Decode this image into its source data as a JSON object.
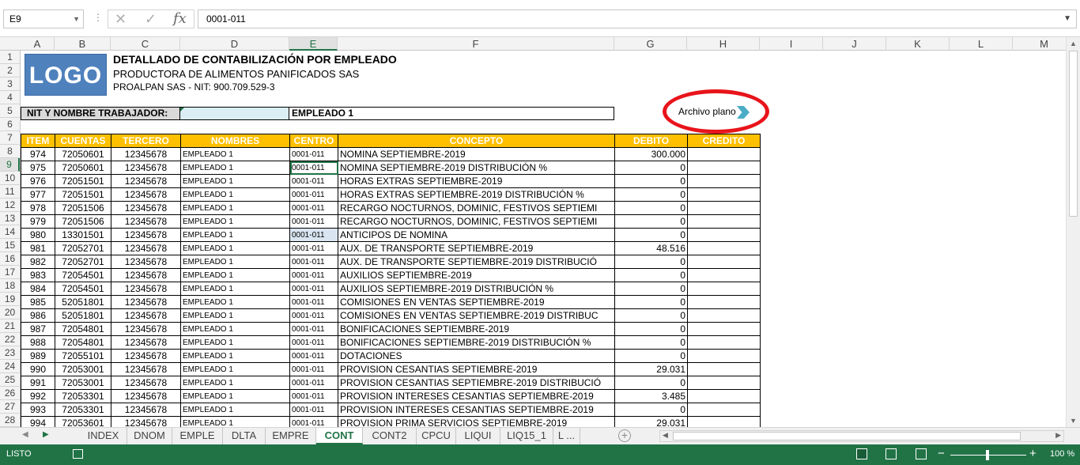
{
  "formula_bar": {
    "name_box": "E9",
    "cancel_icon": "cancel-icon",
    "enter_icon": "check-icon",
    "function_label": "fx",
    "formula_value": "0001-011"
  },
  "columns": [
    "A",
    "B",
    "C",
    "D",
    "E",
    "F",
    "G",
    "H",
    "I",
    "J",
    "K",
    "L",
    "M"
  ],
  "rows": [
    "1",
    "2",
    "3",
    "4",
    "5",
    "6",
    "7",
    "8",
    "9",
    "10",
    "11",
    "12",
    "13",
    "14",
    "15",
    "16",
    "17",
    "18",
    "19",
    "20",
    "21",
    "22",
    "23",
    "24",
    "25",
    "26",
    "27",
    "28"
  ],
  "sheet": {
    "logo_text": "LOGO",
    "title": "DETALLADO DE CONTABILIZACIÓN POR EMPLEADO",
    "company": "PRODUCTORA DE ALIMENTOS PANIFICADOS SAS",
    "nit": "PROALPAN SAS - NIT: 900.709.529-3",
    "worker_label": "NIT Y NOMBRE TRABAJADOR:",
    "worker_name": "EMPLEADO 1",
    "export_button": "Archivo plano",
    "headers": [
      "ITEM",
      "CUENTAS",
      "TERCERO",
      "NOMBRES",
      "CENTRO",
      "CONCEPTO",
      "DEBITO",
      "CREDITO"
    ],
    "rows": [
      {
        "item": "974",
        "cuenta": "72050601",
        "tercero": "12345678",
        "nombre": "EMPLEADO 1",
        "centro": "0001-011",
        "concepto": "NOMINA SEPTIEMBRE-2019",
        "debito": "300.000",
        "credito": ""
      },
      {
        "item": "975",
        "cuenta": "72050601",
        "tercero": "12345678",
        "nombre": "EMPLEADO 1",
        "centro": "0001-011",
        "concepto": "NOMINA SEPTIEMBRE-2019 DISTRIBUCIÓN %",
        "debito": "0",
        "credito": ""
      },
      {
        "item": "976",
        "cuenta": "72051501",
        "tercero": "12345678",
        "nombre": "EMPLEADO 1",
        "centro": "0001-011",
        "concepto": "HORAS EXTRAS SEPTIEMBRE-2019",
        "debito": "0",
        "credito": ""
      },
      {
        "item": "977",
        "cuenta": "72051501",
        "tercero": "12345678",
        "nombre": "EMPLEADO 1",
        "centro": "0001-011",
        "concepto": "HORAS EXTRAS SEPTIEMBRE-2019 DISTRIBUCIÓN %",
        "debito": "0",
        "credito": ""
      },
      {
        "item": "978",
        "cuenta": "72051506",
        "tercero": "12345678",
        "nombre": "EMPLEADO 1",
        "centro": "0001-011",
        "concepto": "RECARGO NOCTURNOS, DOMINIC, FESTIVOS SEPTIEMI",
        "debito": "0",
        "credito": ""
      },
      {
        "item": "979",
        "cuenta": "72051506",
        "tercero": "12345678",
        "nombre": "EMPLEADO 1",
        "centro": "0001-011",
        "concepto": "RECARGO NOCTURNOS, DOMINIC, FESTIVOS SEPTIEMI",
        "debito": "0",
        "credito": ""
      },
      {
        "item": "980",
        "cuenta": "13301501",
        "tercero": "12345678",
        "nombre": "EMPLEADO 1",
        "centro": "0001-011",
        "concepto": "ANTICIPOS DE NOMINA",
        "debito": "0",
        "credito": ""
      },
      {
        "item": "981",
        "cuenta": "72052701",
        "tercero": "12345678",
        "nombre": "EMPLEADO 1",
        "centro": "0001-011",
        "concepto": "AUX. DE TRANSPORTE SEPTIEMBRE-2019",
        "debito": "48.516",
        "credito": ""
      },
      {
        "item": "982",
        "cuenta": "72052701",
        "tercero": "12345678",
        "nombre": "EMPLEADO 1",
        "centro": "0001-011",
        "concepto": "AUX. DE TRANSPORTE SEPTIEMBRE-2019 DISTRIBUCIÓ",
        "debito": "0",
        "credito": ""
      },
      {
        "item": "983",
        "cuenta": "72054501",
        "tercero": "12345678",
        "nombre": "EMPLEADO 1",
        "centro": "0001-011",
        "concepto": "AUXILIOS SEPTIEMBRE-2019",
        "debito": "0",
        "credito": ""
      },
      {
        "item": "984",
        "cuenta": "72054501",
        "tercero": "12345678",
        "nombre": "EMPLEADO 1",
        "centro": "0001-011",
        "concepto": "AUXILIOS SEPTIEMBRE-2019 DISTRIBUCIÓN %",
        "debito": "0",
        "credito": ""
      },
      {
        "item": "985",
        "cuenta": "52051801",
        "tercero": "12345678",
        "nombre": "EMPLEADO 1",
        "centro": "0001-011",
        "concepto": "COMISIONES EN VENTAS SEPTIEMBRE-2019",
        "debito": "0",
        "credito": ""
      },
      {
        "item": "986",
        "cuenta": "52051801",
        "tercero": "12345678",
        "nombre": "EMPLEADO 1",
        "centro": "0001-011",
        "concepto": "COMISIONES EN VENTAS SEPTIEMBRE-2019 DISTRIBUC",
        "debito": "0",
        "credito": ""
      },
      {
        "item": "987",
        "cuenta": "72054801",
        "tercero": "12345678",
        "nombre": "EMPLEADO 1",
        "centro": "0001-011",
        "concepto": "BONIFICACIONES SEPTIEMBRE-2019",
        "debito": "0",
        "credito": ""
      },
      {
        "item": "988",
        "cuenta": "72054801",
        "tercero": "12345678",
        "nombre": "EMPLEADO 1",
        "centro": "0001-011",
        "concepto": "BONIFICACIONES SEPTIEMBRE-2019 DISTRIBUCIÓN %",
        "debito": "0",
        "credito": ""
      },
      {
        "item": "989",
        "cuenta": "72055101",
        "tercero": "12345678",
        "nombre": "EMPLEADO 1",
        "centro": "0001-011",
        "concepto": "DOTACIONES",
        "debito": "0",
        "credito": ""
      },
      {
        "item": "990",
        "cuenta": "72053001",
        "tercero": "12345678",
        "nombre": "EMPLEADO 1",
        "centro": "0001-011",
        "concepto": "PROVISION CESANTIAS SEPTIEMBRE-2019",
        "debito": "29.031",
        "credito": ""
      },
      {
        "item": "991",
        "cuenta": "72053001",
        "tercero": "12345678",
        "nombre": "EMPLEADO 1",
        "centro": "0001-011",
        "concepto": "PROVISION CESANTIAS SEPTIEMBRE-2019 DISTRIBUCIÓ",
        "debito": "0",
        "credito": ""
      },
      {
        "item": "992",
        "cuenta": "72053301",
        "tercero": "12345678",
        "nombre": "EMPLEADO 1",
        "centro": "0001-011",
        "concepto": "PROVISION INTERESES CESANTIAS SEPTIEMBRE-2019",
        "debito": "3.485",
        "credito": ""
      },
      {
        "item": "993",
        "cuenta": "72053301",
        "tercero": "12345678",
        "nombre": "EMPLEADO 1",
        "centro": "0001-011",
        "concepto": "PROVISION INTERESES CESANTIAS SEPTIEMBRE-2019",
        "debito": "0",
        "credito": ""
      },
      {
        "item": "994",
        "cuenta": "72053601",
        "tercero": "12345678",
        "nombre": "EMPLEADO 1",
        "centro": "0001-011",
        "concepto": "PROVISION PRIMA SERVICIOS SEPTIEMBRE-2019",
        "debito": "29.031",
        "credito": ""
      }
    ]
  },
  "tabs": [
    "INDEX",
    "DNOM",
    "EMPLE",
    "DLTA",
    "EMPRE",
    "CONT",
    "CONT2",
    "CPCU",
    "LIQUI",
    "LIQ15_1",
    "L ..."
  ],
  "active_tab": "CONT",
  "status_bar": {
    "ready": "LISTO",
    "zoom": "100 %"
  },
  "colors": {
    "excel_green": "#217346",
    "header_gold": "#ffc000",
    "logo_blue": "#4f81bd",
    "highlight_red": "#e8141b"
  }
}
